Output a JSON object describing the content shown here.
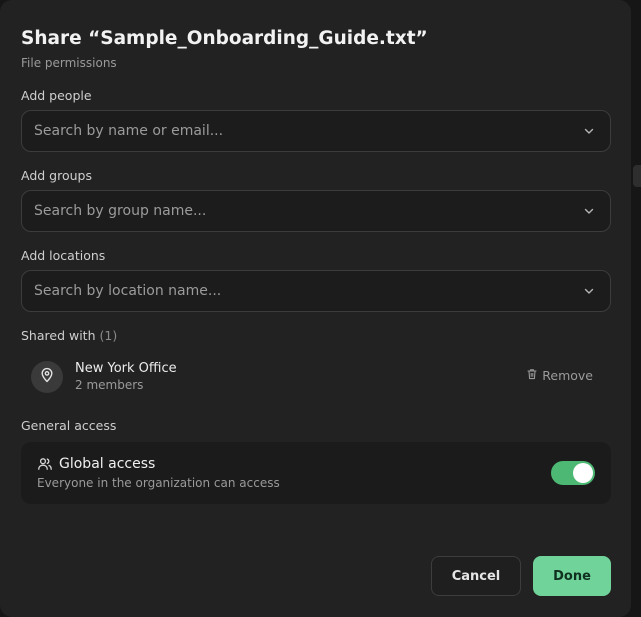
{
  "dialog": {
    "title": "Share “Sample_Onboarding_Guide.txt”",
    "subtitle": "File permissions"
  },
  "fields": {
    "people": {
      "label": "Add people",
      "placeholder": "Search by name or email...",
      "value": ""
    },
    "groups": {
      "label": "Add groups",
      "placeholder": "Search by group name...",
      "value": ""
    },
    "locations": {
      "label": "Add locations",
      "placeholder": "Search by location name...",
      "value": ""
    }
  },
  "shared": {
    "label": "Shared with",
    "count": "(1)",
    "items": [
      {
        "name": "New York Office",
        "meta": "2 members",
        "icon": "location-pin-icon",
        "remove_label": "Remove"
      }
    ]
  },
  "general": {
    "label": "General access",
    "title": "Global access",
    "description": "Everyone in the organization can access",
    "icon": "users-icon",
    "enabled": true
  },
  "footer": {
    "cancel_label": "Cancel",
    "done_label": "Done"
  },
  "colors": {
    "accent": "#6fd39a",
    "toggle_on": "#4cb873",
    "background": "#222222"
  }
}
